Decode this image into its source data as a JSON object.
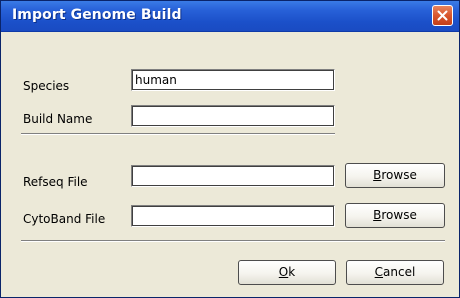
{
  "window": {
    "title": "Import Genome Build"
  },
  "form": {
    "species": {
      "label": "Species",
      "value": "human"
    },
    "build_name": {
      "label": "Build Name",
      "value": ""
    },
    "refseq_file": {
      "label": "Refseq File",
      "value": ""
    },
    "cytoband_file": {
      "label": "CytoBand File",
      "value": ""
    }
  },
  "buttons": {
    "browse_refseq": {
      "accel": "B",
      "rest": "rowse"
    },
    "browse_cytoband": {
      "accel": "B",
      "rest": "rowse"
    },
    "ok": {
      "accel": "O",
      "rest": "k"
    },
    "cancel": {
      "accel": "C",
      "rest": "ancel"
    }
  },
  "icons": {
    "close": "close-icon"
  },
  "colors": {
    "titlebar": "#2861d8",
    "close_button": "#d9562d",
    "dialog_background": "#ece9d8"
  }
}
